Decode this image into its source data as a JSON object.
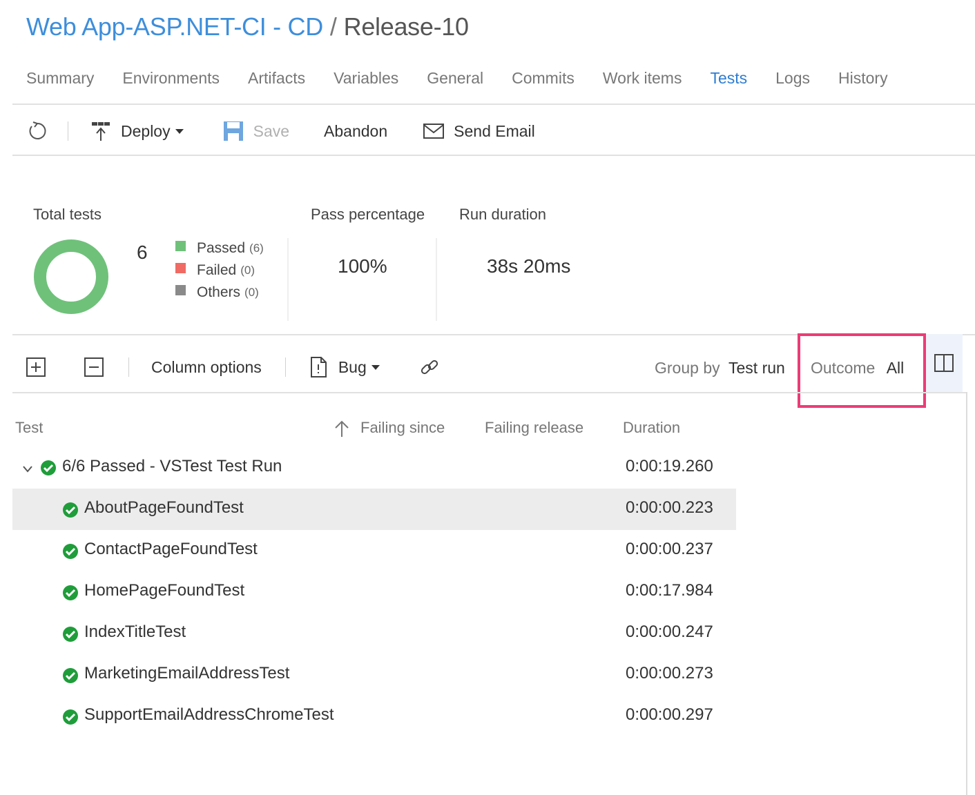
{
  "breadcrumb": {
    "definition": "Web App-ASP.NET-CI - CD",
    "separator": "/",
    "release": "Release-10"
  },
  "tabs": [
    {
      "label": "Summary",
      "active": false
    },
    {
      "label": "Environments",
      "active": false
    },
    {
      "label": "Artifacts",
      "active": false
    },
    {
      "label": "Variables",
      "active": false
    },
    {
      "label": "General",
      "active": false
    },
    {
      "label": "Commits",
      "active": false
    },
    {
      "label": "Work items",
      "active": false
    },
    {
      "label": "Tests",
      "active": true
    },
    {
      "label": "Logs",
      "active": false
    },
    {
      "label": "History",
      "active": false
    }
  ],
  "toolbar": {
    "refresh_icon": "refresh-icon",
    "deploy_label": "Deploy",
    "save_label": "Save",
    "abandon_label": "Abandon",
    "send_email_label": "Send Email"
  },
  "summary": {
    "total_tests_label": "Total tests",
    "total_tests_value": "6",
    "legend": [
      {
        "label": "Passed",
        "count": "(6)",
        "color": "#6fc17a"
      },
      {
        "label": "Failed",
        "count": "(0)",
        "color": "#ef6b64"
      },
      {
        "label": "Others",
        "count": "(0)",
        "color": "#8a8a8a"
      }
    ],
    "pass_percentage_label": "Pass percentage",
    "pass_percentage_value": "100%",
    "run_duration_label": "Run duration",
    "run_duration_value": "38s 20ms",
    "donut_color": "#6fc17a"
  },
  "grid_toolbar": {
    "column_options_label": "Column options",
    "bug_label": "Bug",
    "group_by_label": "Group by",
    "group_by_value": "Test run",
    "outcome_label": "Outcome",
    "outcome_value": "All"
  },
  "columns": {
    "test": "Test",
    "failing_since": "Failing since",
    "failing_release": "Failing release",
    "duration": "Duration"
  },
  "group": {
    "label": "6/6 Passed - VSTest Test Run",
    "duration": "0:00:19.260"
  },
  "tests": [
    {
      "name": "AboutPageFoundTest",
      "duration": "0:00:00.223",
      "selected": true
    },
    {
      "name": "ContactPageFoundTest",
      "duration": "0:00:00.237",
      "selected": false
    },
    {
      "name": "HomePageFoundTest",
      "duration": "0:00:17.984",
      "selected": false
    },
    {
      "name": "IndexTitleTest",
      "duration": "0:00:00.247",
      "selected": false
    },
    {
      "name": "MarketingEmailAddressTest",
      "duration": "0:00:00.273",
      "selected": false
    },
    {
      "name": "SupportEmailAddressChromeTest",
      "duration": "0:00:00.297",
      "selected": false
    }
  ],
  "colors": {
    "accent": "#2d7dd2",
    "pass_green": "#1f9d3a",
    "highlight": "#ec3b76"
  }
}
